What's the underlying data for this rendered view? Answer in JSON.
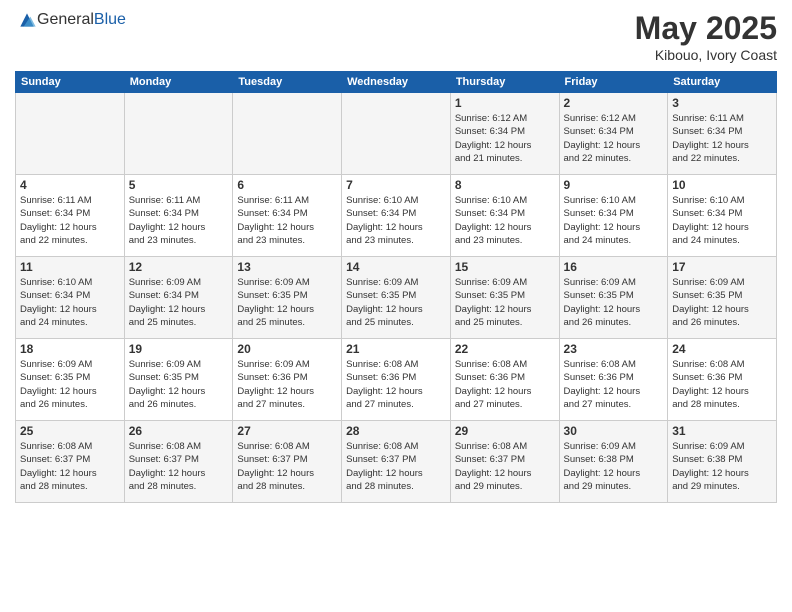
{
  "header": {
    "logo_general": "General",
    "logo_blue": "Blue",
    "month_year": "May 2025",
    "location": "Kibouo, Ivory Coast"
  },
  "weekdays": [
    "Sunday",
    "Monday",
    "Tuesday",
    "Wednesday",
    "Thursday",
    "Friday",
    "Saturday"
  ],
  "weeks": [
    [
      {
        "day": "",
        "info": ""
      },
      {
        "day": "",
        "info": ""
      },
      {
        "day": "",
        "info": ""
      },
      {
        "day": "",
        "info": ""
      },
      {
        "day": "1",
        "info": "Sunrise: 6:12 AM\nSunset: 6:34 PM\nDaylight: 12 hours\nand 21 minutes."
      },
      {
        "day": "2",
        "info": "Sunrise: 6:12 AM\nSunset: 6:34 PM\nDaylight: 12 hours\nand 22 minutes."
      },
      {
        "day": "3",
        "info": "Sunrise: 6:11 AM\nSunset: 6:34 PM\nDaylight: 12 hours\nand 22 minutes."
      }
    ],
    [
      {
        "day": "4",
        "info": "Sunrise: 6:11 AM\nSunset: 6:34 PM\nDaylight: 12 hours\nand 22 minutes."
      },
      {
        "day": "5",
        "info": "Sunrise: 6:11 AM\nSunset: 6:34 PM\nDaylight: 12 hours\nand 23 minutes."
      },
      {
        "day": "6",
        "info": "Sunrise: 6:11 AM\nSunset: 6:34 PM\nDaylight: 12 hours\nand 23 minutes."
      },
      {
        "day": "7",
        "info": "Sunrise: 6:10 AM\nSunset: 6:34 PM\nDaylight: 12 hours\nand 23 minutes."
      },
      {
        "day": "8",
        "info": "Sunrise: 6:10 AM\nSunset: 6:34 PM\nDaylight: 12 hours\nand 23 minutes."
      },
      {
        "day": "9",
        "info": "Sunrise: 6:10 AM\nSunset: 6:34 PM\nDaylight: 12 hours\nand 24 minutes."
      },
      {
        "day": "10",
        "info": "Sunrise: 6:10 AM\nSunset: 6:34 PM\nDaylight: 12 hours\nand 24 minutes."
      }
    ],
    [
      {
        "day": "11",
        "info": "Sunrise: 6:10 AM\nSunset: 6:34 PM\nDaylight: 12 hours\nand 24 minutes."
      },
      {
        "day": "12",
        "info": "Sunrise: 6:09 AM\nSunset: 6:34 PM\nDaylight: 12 hours\nand 25 minutes."
      },
      {
        "day": "13",
        "info": "Sunrise: 6:09 AM\nSunset: 6:35 PM\nDaylight: 12 hours\nand 25 minutes."
      },
      {
        "day": "14",
        "info": "Sunrise: 6:09 AM\nSunset: 6:35 PM\nDaylight: 12 hours\nand 25 minutes."
      },
      {
        "day": "15",
        "info": "Sunrise: 6:09 AM\nSunset: 6:35 PM\nDaylight: 12 hours\nand 25 minutes."
      },
      {
        "day": "16",
        "info": "Sunrise: 6:09 AM\nSunset: 6:35 PM\nDaylight: 12 hours\nand 26 minutes."
      },
      {
        "day": "17",
        "info": "Sunrise: 6:09 AM\nSunset: 6:35 PM\nDaylight: 12 hours\nand 26 minutes."
      }
    ],
    [
      {
        "day": "18",
        "info": "Sunrise: 6:09 AM\nSunset: 6:35 PM\nDaylight: 12 hours\nand 26 minutes."
      },
      {
        "day": "19",
        "info": "Sunrise: 6:09 AM\nSunset: 6:35 PM\nDaylight: 12 hours\nand 26 minutes."
      },
      {
        "day": "20",
        "info": "Sunrise: 6:09 AM\nSunset: 6:36 PM\nDaylight: 12 hours\nand 27 minutes."
      },
      {
        "day": "21",
        "info": "Sunrise: 6:08 AM\nSunset: 6:36 PM\nDaylight: 12 hours\nand 27 minutes."
      },
      {
        "day": "22",
        "info": "Sunrise: 6:08 AM\nSunset: 6:36 PM\nDaylight: 12 hours\nand 27 minutes."
      },
      {
        "day": "23",
        "info": "Sunrise: 6:08 AM\nSunset: 6:36 PM\nDaylight: 12 hours\nand 27 minutes."
      },
      {
        "day": "24",
        "info": "Sunrise: 6:08 AM\nSunset: 6:36 PM\nDaylight: 12 hours\nand 28 minutes."
      }
    ],
    [
      {
        "day": "25",
        "info": "Sunrise: 6:08 AM\nSunset: 6:37 PM\nDaylight: 12 hours\nand 28 minutes."
      },
      {
        "day": "26",
        "info": "Sunrise: 6:08 AM\nSunset: 6:37 PM\nDaylight: 12 hours\nand 28 minutes."
      },
      {
        "day": "27",
        "info": "Sunrise: 6:08 AM\nSunset: 6:37 PM\nDaylight: 12 hours\nand 28 minutes."
      },
      {
        "day": "28",
        "info": "Sunrise: 6:08 AM\nSunset: 6:37 PM\nDaylight: 12 hours\nand 28 minutes."
      },
      {
        "day": "29",
        "info": "Sunrise: 6:08 AM\nSunset: 6:37 PM\nDaylight: 12 hours\nand 29 minutes."
      },
      {
        "day": "30",
        "info": "Sunrise: 6:09 AM\nSunset: 6:38 PM\nDaylight: 12 hours\nand 29 minutes."
      },
      {
        "day": "31",
        "info": "Sunrise: 6:09 AM\nSunset: 6:38 PM\nDaylight: 12 hours\nand 29 minutes."
      }
    ]
  ]
}
